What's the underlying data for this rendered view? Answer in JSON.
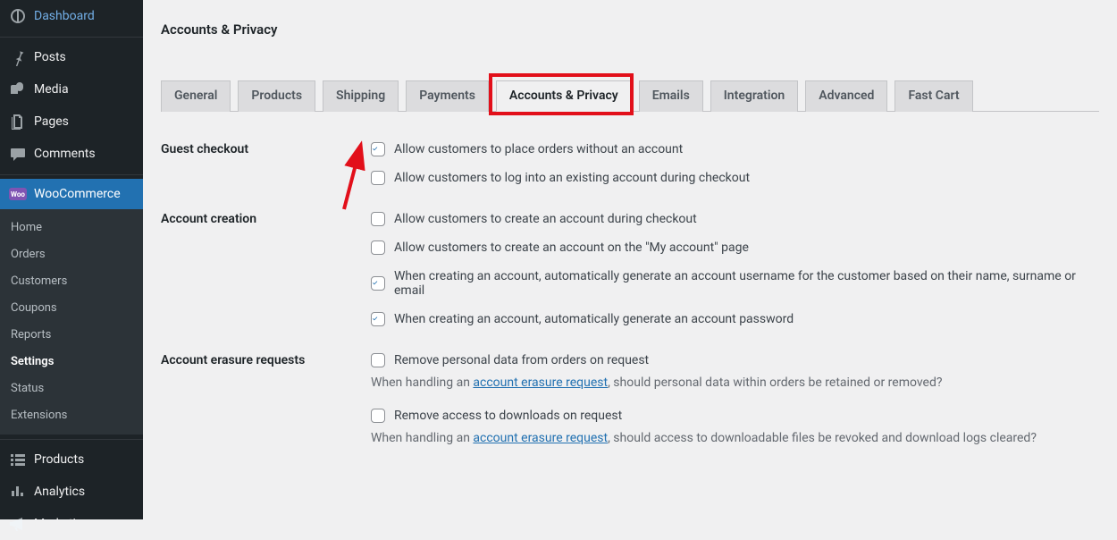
{
  "sidebar": {
    "items": [
      {
        "label": "Dashboard",
        "icon": "dashboard"
      },
      {
        "label": "Posts",
        "icon": "pin"
      },
      {
        "label": "Media",
        "icon": "media"
      },
      {
        "label": "Pages",
        "icon": "pages"
      },
      {
        "label": "Comments",
        "icon": "comment"
      },
      {
        "label": "WooCommerce",
        "icon": "woo",
        "active": true
      },
      {
        "label": "Products",
        "icon": "products"
      },
      {
        "label": "Analytics",
        "icon": "analytics"
      },
      {
        "label": "Marketing",
        "icon": "marketing"
      }
    ],
    "submenu": [
      {
        "label": "Home"
      },
      {
        "label": "Orders"
      },
      {
        "label": "Customers"
      },
      {
        "label": "Coupons"
      },
      {
        "label": "Reports"
      },
      {
        "label": "Settings",
        "current": true
      },
      {
        "label": "Status"
      },
      {
        "label": "Extensions"
      }
    ]
  },
  "page": {
    "title": "Accounts & Privacy"
  },
  "tabs": [
    {
      "label": "General"
    },
    {
      "label": "Products"
    },
    {
      "label": "Shipping"
    },
    {
      "label": "Payments"
    },
    {
      "label": "Accounts & Privacy",
      "active": true,
      "highlighted": true
    },
    {
      "label": "Emails"
    },
    {
      "label": "Integration"
    },
    {
      "label": "Advanced"
    },
    {
      "label": "Fast Cart"
    }
  ],
  "sections": {
    "guest_checkout": {
      "heading": "Guest checkout",
      "opts": [
        {
          "label": "Allow customers to place orders without an account",
          "checked": true
        },
        {
          "label": "Allow customers to log into an existing account during checkout",
          "checked": false
        }
      ]
    },
    "account_creation": {
      "heading": "Account creation",
      "opts": [
        {
          "label": "Allow customers to create an account during checkout",
          "checked": false
        },
        {
          "label": "Allow customers to create an account on the \"My account\" page",
          "checked": false
        },
        {
          "label": "When creating an account, automatically generate an account username for the customer based on their name, surname or email",
          "checked": true
        },
        {
          "label": "When creating an account, automatically generate an account password",
          "checked": true
        }
      ]
    },
    "erasure": {
      "heading": "Account erasure requests",
      "opts": [
        {
          "label": "Remove personal data from orders on request",
          "checked": false,
          "help_pre": "When handling an ",
          "help_link": "account erasure request",
          "help_post": ", should personal data within orders be retained or removed?"
        },
        {
          "label": "Remove access to downloads on request",
          "checked": false,
          "help_pre": "When handling an ",
          "help_link": "account erasure request",
          "help_post": ", should access to downloadable files be revoked and download logs cleared?"
        }
      ]
    }
  },
  "annotation": {
    "highlight_color": "#e20f1a",
    "arrow_color": "#e20f1a"
  }
}
